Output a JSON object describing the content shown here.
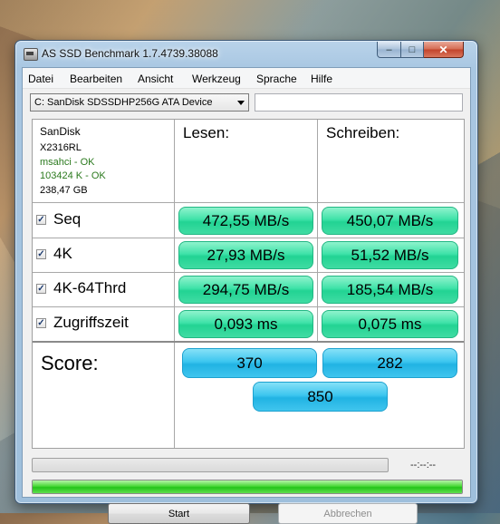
{
  "window": {
    "title": "AS SSD Benchmark 1.7.4739.38088",
    "minimize_glyph": "–",
    "maximize_glyph": "□",
    "close_glyph": "✕"
  },
  "menu": [
    "Datei",
    "Bearbeiten",
    "Ansicht",
    "Werkzeug",
    "Sprache",
    "Hilfe"
  ],
  "drive": {
    "selected": "C: SanDisk SDSSDHP256G ATA Device",
    "text_field_value": ""
  },
  "drive_info": {
    "vendor": "SanDisk",
    "firmware": "X2316RL",
    "driver_status": "msahci - OK",
    "alignment_status": "103424 K - OK",
    "capacity": "238,47 GB"
  },
  "columns": {
    "read": "Lesen:",
    "write": "Schreiben:"
  },
  "rows": [
    {
      "label": "Seq",
      "checked": true,
      "read": "472,55 MB/s",
      "write": "450,07 MB/s"
    },
    {
      "label": "4K",
      "checked": true,
      "read": "27,93 MB/s",
      "write": "51,52 MB/s"
    },
    {
      "label": "4K-64Thrd",
      "checked": true,
      "read": "294,75 MB/s",
      "write": "185,54 MB/s"
    },
    {
      "label": "Zugriffszeit",
      "checked": true,
      "read": "0,093 ms",
      "write": "0,075 ms"
    }
  ],
  "score": {
    "label": "Score:",
    "read": "370",
    "write": "282",
    "total": "850"
  },
  "progress": {
    "time_readout": "--:--:--",
    "top_fraction": 0,
    "bottom_fraction": 1.0
  },
  "buttons": {
    "start": "Start",
    "abort": "Abbrechen"
  },
  "colors": {
    "result_green": "#3fe2a8",
    "score_blue": "#21b3e3",
    "ok_text": "#2b7a1e",
    "progress_green": "#24c41a"
  }
}
